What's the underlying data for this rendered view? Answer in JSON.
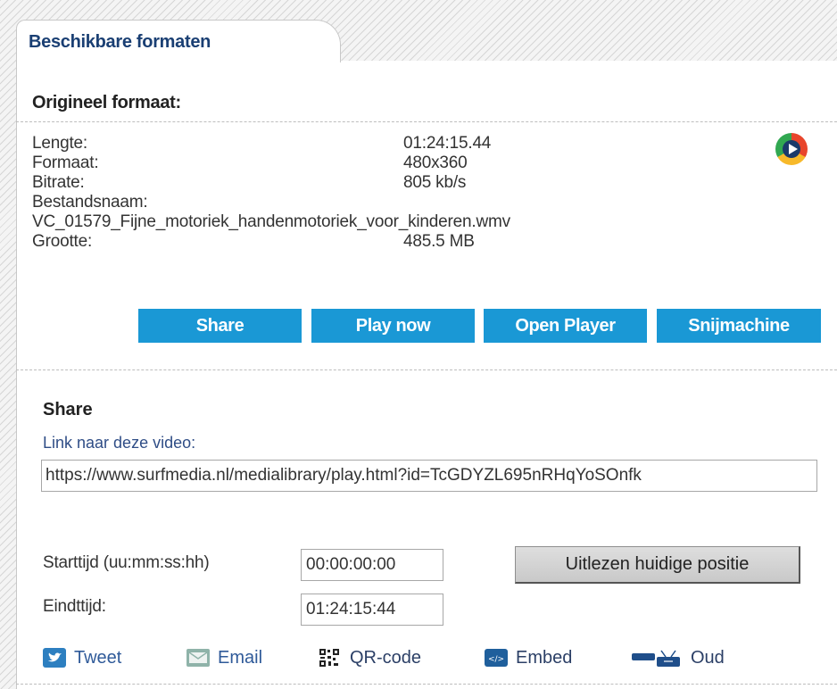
{
  "tab": {
    "label": "Beschikbare formaten"
  },
  "original": {
    "title": "Origineel formaat:",
    "length_label": "Lengte:",
    "length_value": "01:24:15.44",
    "format_label": "Formaat:",
    "format_value": "480x360",
    "bitrate_label": "Bitrate:",
    "bitrate_value": "805 kb/s",
    "filename_label": "Bestandsnaam:",
    "filename_value": "VC_01579_Fijne_motoriek_handenmotoriek_voor_kinderen.wmv",
    "size_label": "Grootte:",
    "size_value": "485.5 MB"
  },
  "buttons": {
    "share": "Share",
    "play_now": "Play now",
    "open_player": "Open Player",
    "cutter": "Snijmachine"
  },
  "share": {
    "title": "Share",
    "link_label": "Link naar deze video:",
    "link_value": "https://www.surfmedia.nl/medialibrary/play.html?id=TcGDYZL695nRHqYoSOnfk",
    "start_label": "Starttijd (uu:mm:ss:hh)",
    "start_value": "00:00:00:00",
    "end_label": "Eindttijd:",
    "end_value": "01:24:15:44",
    "read_position_button": "Uitlezen huidige positie"
  },
  "social": {
    "tweet": "Tweet",
    "email": "Email",
    "qr": "QR-code",
    "embed": "Embed",
    "old": "Oud"
  },
  "colors": {
    "accent_blue": "#1a98d5",
    "link_blue": "#2f5a99",
    "tab_title": "#1a3f73"
  }
}
